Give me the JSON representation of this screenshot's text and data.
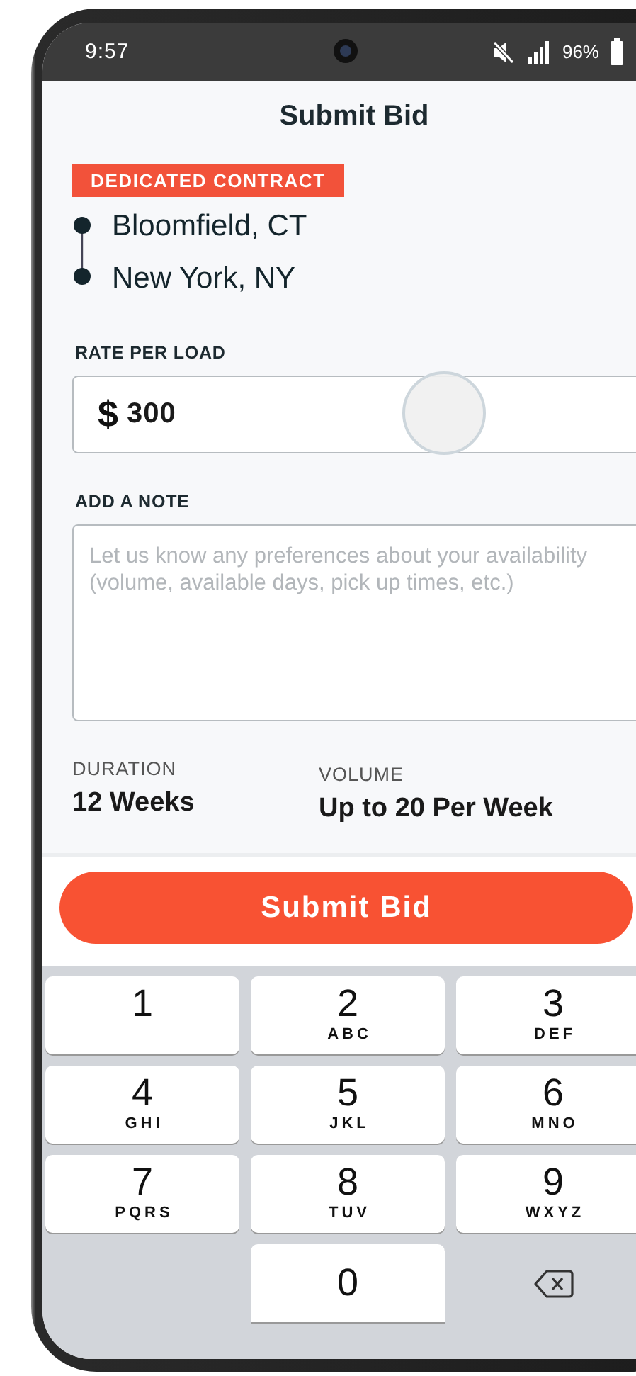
{
  "status_bar": {
    "time": "9:57",
    "battery": "96%"
  },
  "title": "Submit Bid",
  "tag": "DEDICATED CONTRACT",
  "route": [
    {
      "place": "Bloomfield, CT"
    },
    {
      "place": "New York, NY"
    }
  ],
  "rate": {
    "label": "RATE PER LOAD",
    "currency": "$",
    "value": "300"
  },
  "note": {
    "label": "ADD A NOTE",
    "placeholder": "Let us know any preferences about your availability (volume, available days, pick up times, etc.)"
  },
  "details": [
    {
      "label": "DURATION",
      "value": "12 Weeks"
    },
    {
      "label": "VOLUME",
      "value": "Up to 20 Per Week"
    }
  ],
  "submit_button": "Submit Bid",
  "keypad": [
    {
      "kind": "digit",
      "digit": "1"
    },
    {
      "kind": "digit",
      "digit": "2",
      "letters": "ABC"
    },
    {
      "kind": "digit",
      "digit": "3",
      "letters": "DEF"
    },
    {
      "kind": "digit",
      "digit": "4",
      "letters": "GHI"
    },
    {
      "kind": "digit",
      "digit": "5",
      "letters": "JKL"
    },
    {
      "kind": "digit",
      "digit": "6",
      "letters": "MNO"
    },
    {
      "kind": "digit",
      "digit": "7",
      "letters": "PQRS"
    },
    {
      "kind": "digit",
      "digit": "8",
      "letters": "TUV"
    },
    {
      "kind": "digit",
      "digit": "9",
      "letters": "WXYZ"
    },
    {
      "kind": "digit",
      "digit": "0"
    },
    {
      "kind": "backspace"
    }
  ]
}
